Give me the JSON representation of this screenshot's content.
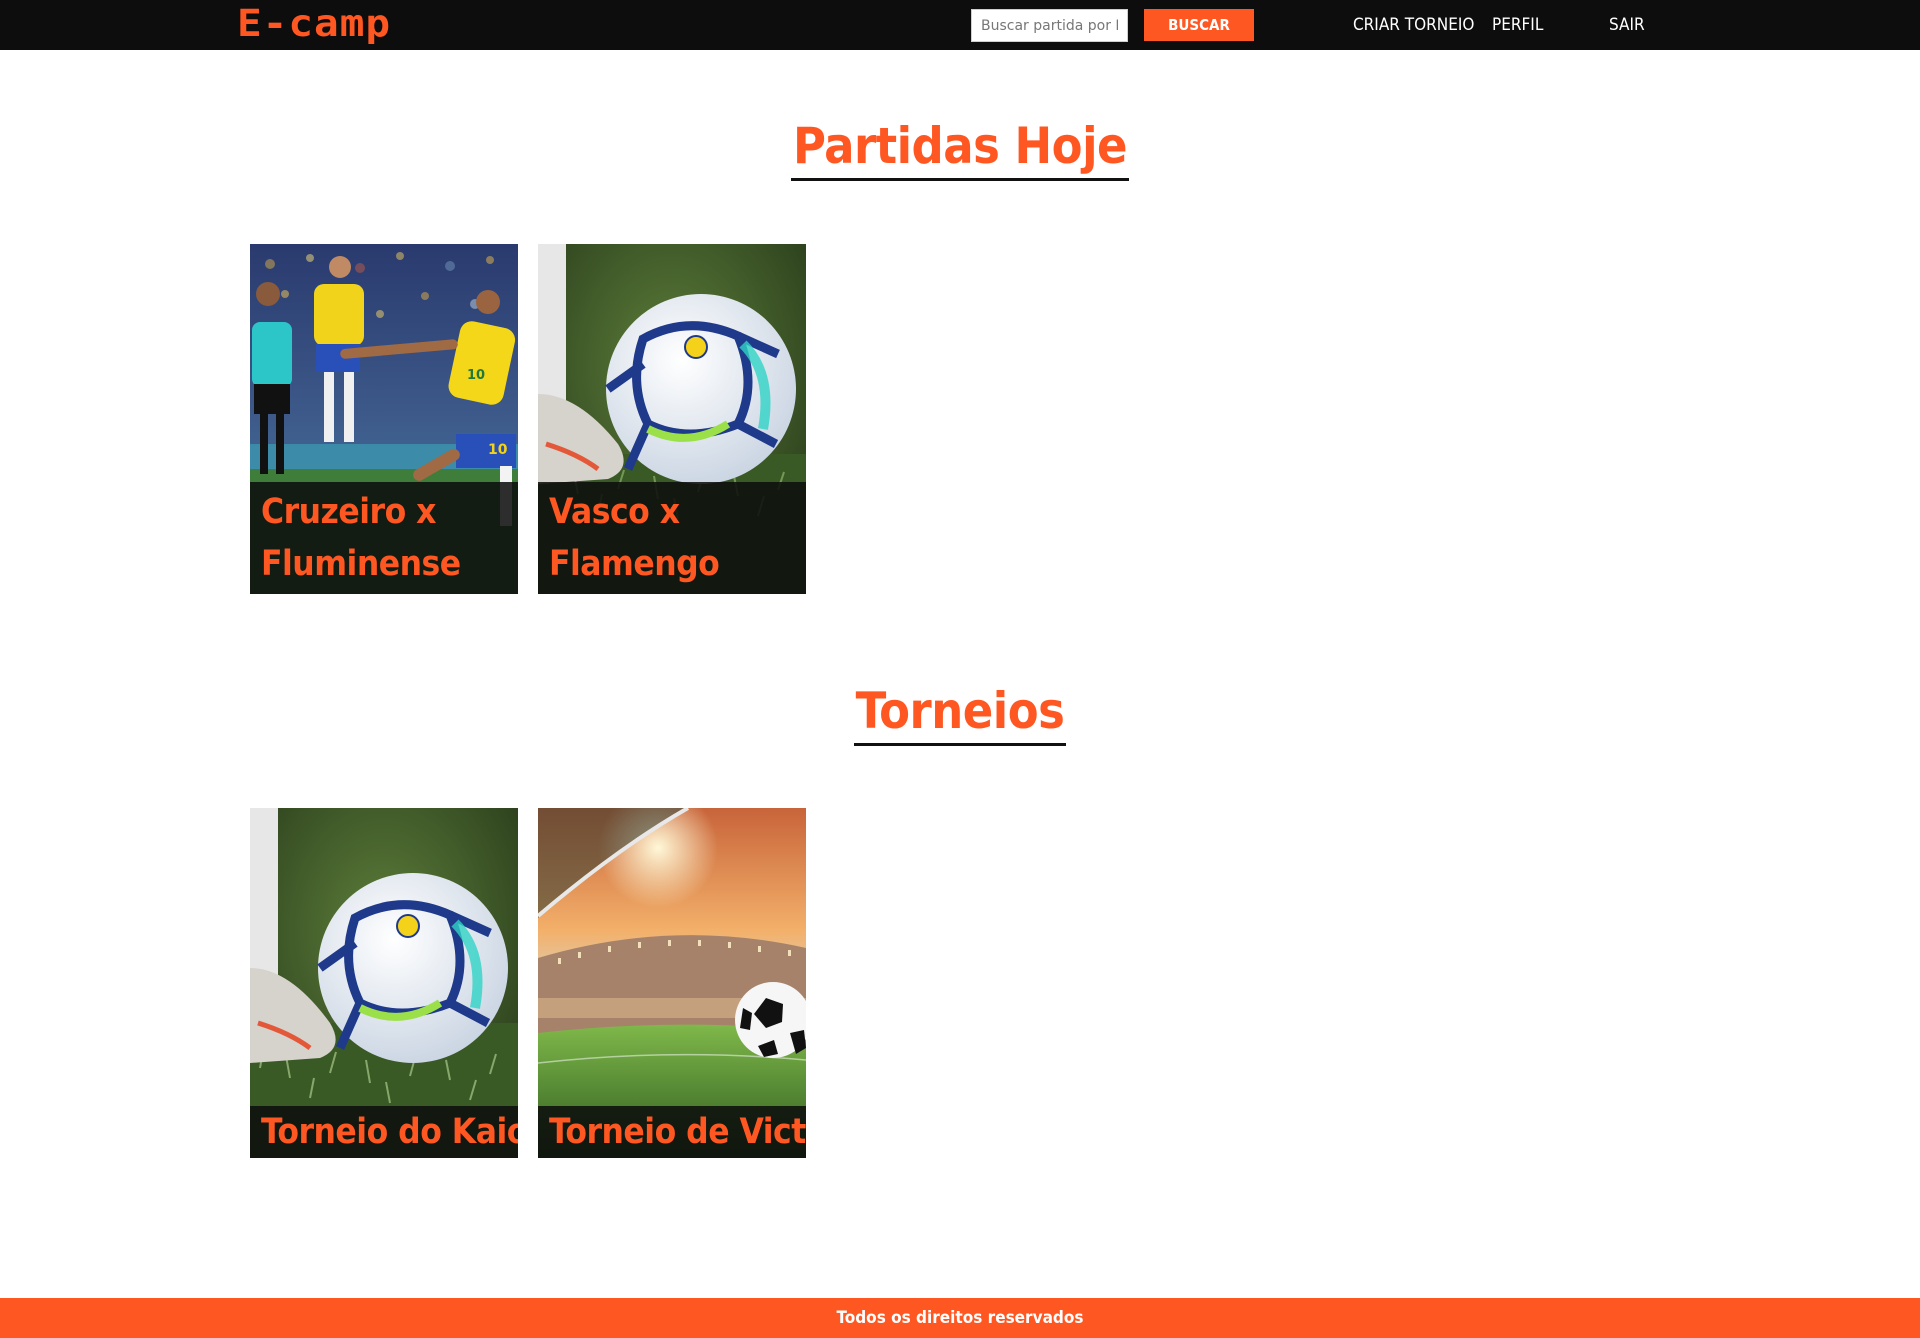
{
  "header": {
    "logo_text": "E-camp",
    "search_placeholder": "Buscar partida por ID",
    "search_value": "",
    "search_button": "BUSCAR",
    "nav": {
      "criar_torneio": "CRIAR TORNEIO",
      "perfil": "PERFIL",
      "sair": "SAIR"
    }
  },
  "sections": {
    "partidas": {
      "title": "Partidas Hoje",
      "cards": [
        {
          "label": "Cruzeiro x Fluminense",
          "image": "players-photo"
        },
        {
          "label": "Vasco x Flamengo",
          "image": "ball-photo"
        }
      ]
    },
    "torneios": {
      "title": "Torneios",
      "cards": [
        {
          "label": "Torneio do Kaio",
          "image": "ball-photo"
        },
        {
          "label": "Torneio de Victor",
          "image": "stadium-photo"
        }
      ]
    }
  },
  "footer": {
    "text": "Todos os direitos reservados"
  },
  "colors": {
    "accent": "#ff5722",
    "topbar": "#0d0d0d",
    "background": "#ffffff"
  }
}
